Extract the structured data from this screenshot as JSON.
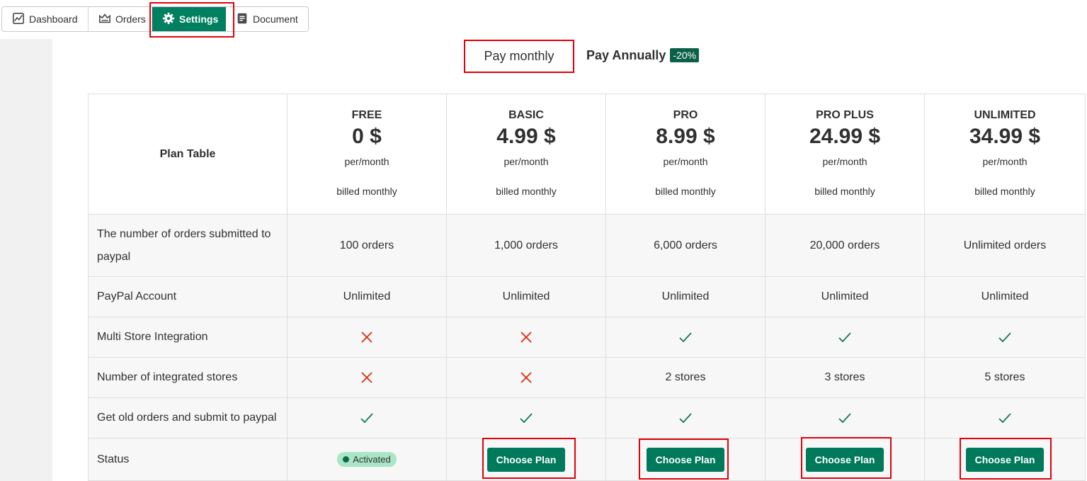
{
  "nav": {
    "items": [
      {
        "label": "Dashboard",
        "icon": "dashboard-chart-icon"
      },
      {
        "label": "Orders",
        "icon": "orders-icon"
      },
      {
        "label": "Settings",
        "icon": "gear-icon",
        "active": true
      },
      {
        "label": "Document",
        "icon": "document-icon"
      }
    ]
  },
  "billing": {
    "monthly_label": "Pay monthly",
    "annually_label": "Pay Annually",
    "discount": "-20%"
  },
  "table": {
    "title": "Plan Table",
    "plans": [
      {
        "name": "FREE",
        "price": "0 $",
        "per": "per/month",
        "billed": "billed monthly"
      },
      {
        "name": "BASIC",
        "price": "4.99 $",
        "per": "per/month",
        "billed": "billed monthly"
      },
      {
        "name": "PRO",
        "price": "8.99 $",
        "per": "per/month",
        "billed": "billed monthly"
      },
      {
        "name": "PRO PLUS",
        "price": "24.99 $",
        "per": "per/month",
        "billed": "billed monthly"
      },
      {
        "name": "UNLIMITED",
        "price": "34.99 $",
        "per": "per/month",
        "billed": "billed monthly"
      }
    ],
    "rows": {
      "orders": {
        "label": "The number of orders submitted to paypal",
        "values": [
          "100 orders",
          "1,000 orders",
          "6,000 orders",
          "20,000 orders",
          "Unlimited orders"
        ]
      },
      "paypal": {
        "label": "PayPal Account",
        "values": [
          "Unlimited",
          "Unlimited",
          "Unlimited",
          "Unlimited",
          "Unlimited"
        ]
      },
      "multi": {
        "label": "Multi Store Integration",
        "values": [
          "no",
          "no",
          "yes",
          "yes",
          "yes"
        ]
      },
      "stores": {
        "label": "Number of integrated stores",
        "values": [
          "no",
          "no",
          "2 stores",
          "3 stores",
          "5 stores"
        ]
      },
      "old": {
        "label": "Get old orders and submit to paypal",
        "values": [
          "yes",
          "yes",
          "yes",
          "yes",
          "yes"
        ]
      },
      "status": {
        "label": "Status",
        "activated_label": "Activated",
        "choose_label": "Choose Plan"
      }
    }
  },
  "colors": {
    "accent": "#008060",
    "check": "#0b7a55",
    "cross": "#d82c0d",
    "highlight": "#e3000b"
  }
}
